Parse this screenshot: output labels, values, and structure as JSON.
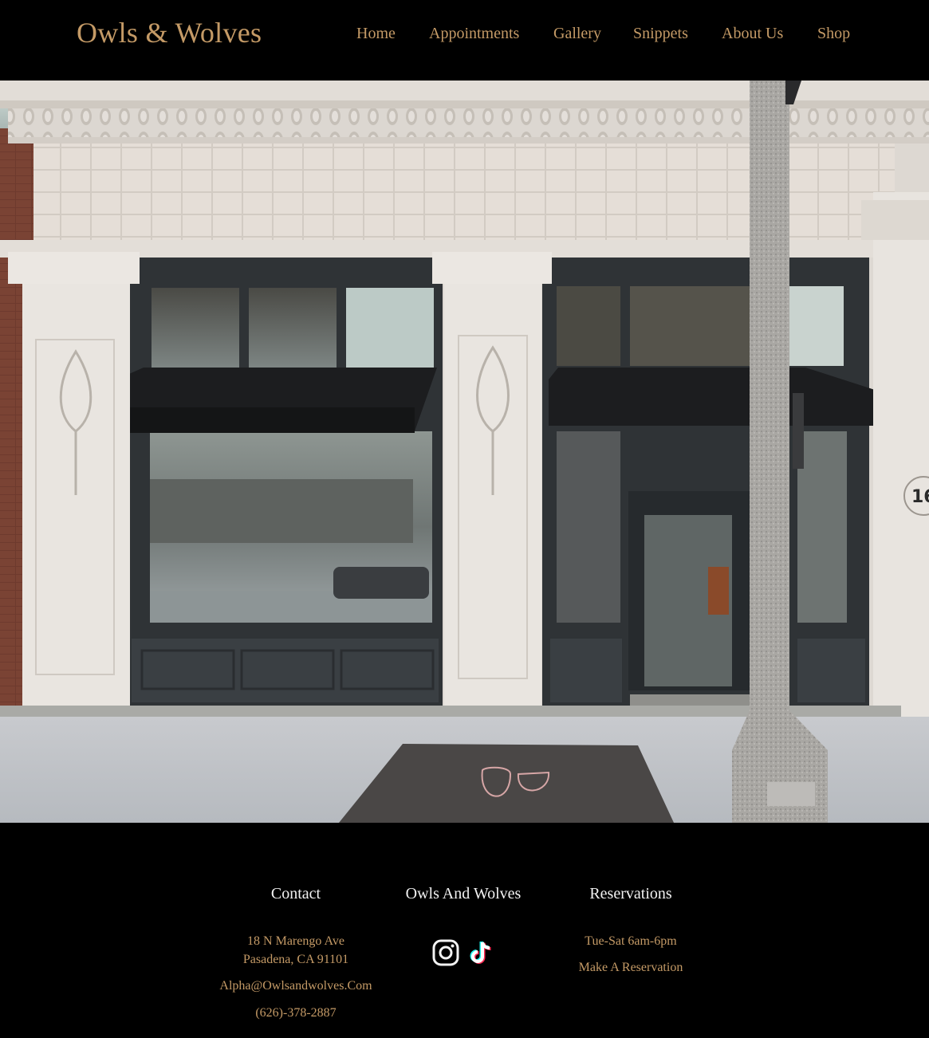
{
  "brand": {
    "logo_text": "Owls & Wolves"
  },
  "nav": {
    "items": [
      {
        "label": "Home"
      },
      {
        "label": "Appointments"
      },
      {
        "label": "Gallery"
      },
      {
        "label": "Snippets"
      },
      {
        "label": "About Us"
      },
      {
        "label": "Shop"
      }
    ]
  },
  "hero": {
    "storefront_number_fragment": "16"
  },
  "footer": {
    "contact": {
      "title": "Contact",
      "address_line1": "18 N Marengo Ave",
      "address_line2": "Pasadena, CA 91101",
      "email": "Alpha@Owlsandwolves.Com",
      "phone": "(626)-378-2887"
    },
    "brand_col": {
      "title": "Owls And Wolves",
      "social": [
        {
          "icon": "instagram-icon"
        },
        {
          "icon": "tiktok-icon"
        }
      ]
    },
    "reservations": {
      "title": "Reservations",
      "hours": "Tue-Sat 6am-6pm",
      "cta": "Make A Reservation"
    }
  },
  "colors": {
    "accent_gold": "#c49a66",
    "background": "#000000",
    "heading_white": "#f2f2f2"
  }
}
